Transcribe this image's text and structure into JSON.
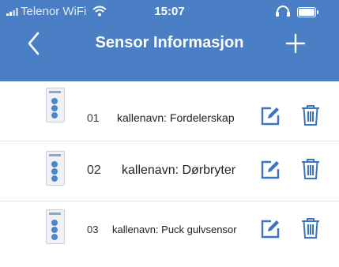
{
  "status_bar": {
    "carrier": "Telenor WiFi",
    "time": "15:07"
  },
  "nav": {
    "title": "Sensor Informasjon",
    "back_icon": "chevron-left-icon",
    "add_icon": "plus-icon"
  },
  "sensors": [
    {
      "number": "01",
      "label": "kallenavn: Fordelerskap"
    },
    {
      "number": "02",
      "label": "kallenavn: Dørbryter"
    },
    {
      "number": "03",
      "label": "kallenavn: Puck gulvsensor"
    }
  ],
  "colors": {
    "header": "#4a7ec5",
    "accent": "#3b74c4",
    "divider": "#e3e3e3"
  }
}
